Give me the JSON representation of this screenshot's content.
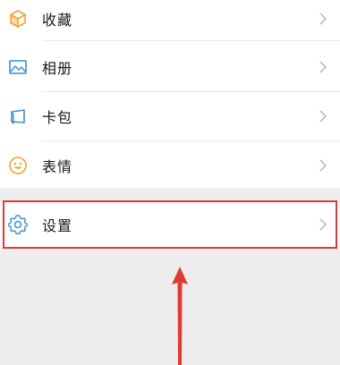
{
  "menu": {
    "items": [
      {
        "label": "收藏",
        "icon": "favorites-cube-icon"
      },
      {
        "label": "相册",
        "icon": "album-picture-icon"
      },
      {
        "label": "卡包",
        "icon": "card-wallet-icon"
      },
      {
        "label": "表情",
        "icon": "emoji-smile-icon"
      }
    ],
    "settings": {
      "label": "设置",
      "icon": "settings-gear-icon"
    }
  },
  "colors": {
    "background": "#ededed",
    "row": "#ffffff",
    "text": "#1a1a1a",
    "chevron": "#b2b2b2",
    "annotation": "#e03a33",
    "favorites_icon": "#f2a12b",
    "album_icon": "#3b8fd5",
    "card_icon": "#3b8fd5",
    "emoji_icon": "#f2a12b",
    "settings_icon": "#3b8fd5"
  }
}
